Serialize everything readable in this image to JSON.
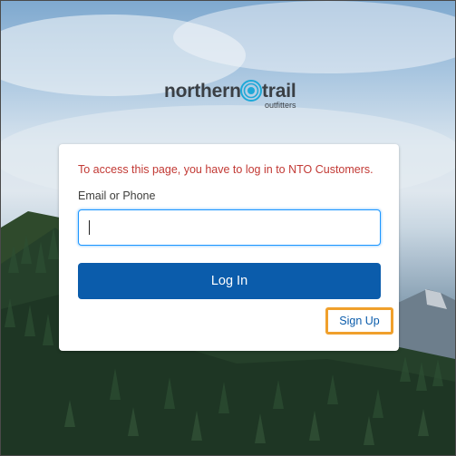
{
  "brand": {
    "name_part1": "northern",
    "name_part2": "trail",
    "tagline": "outfitters",
    "logo_icon": "northern-trail-emblem-icon",
    "accent_color": "#1fa9d8"
  },
  "login": {
    "error_message": "To access this page, you have to log in to NTO Customers.",
    "username_label": "Email or Phone",
    "username_value": "",
    "login_button": "Log In",
    "signup_link": "Sign Up"
  },
  "colors": {
    "error": "#c23934",
    "primary_button": "#0b5cab",
    "link": "#0b5cab",
    "highlight": "#f0a02c",
    "input_focus": "#1b96ff"
  }
}
